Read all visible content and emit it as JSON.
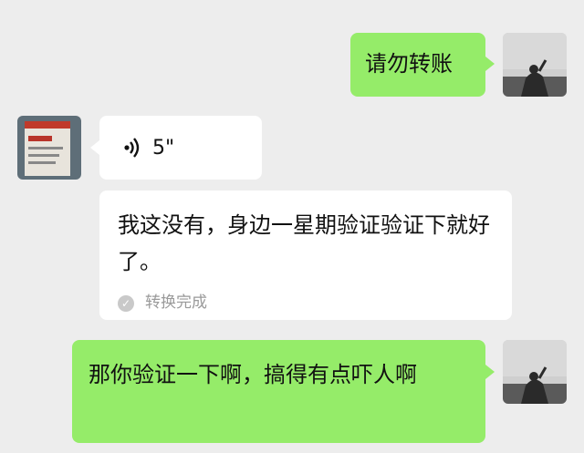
{
  "messages": {
    "m1": {
      "text": "请勿转账"
    },
    "m2": {
      "duration": "5\""
    },
    "m3": {
      "transcript": "我这没有，身边一星期验证验证下就好了。",
      "status": "转换完成"
    },
    "m4": {
      "text": "那你验证一下啊，搞得有点吓人啊"
    }
  },
  "icons": {
    "voice": "voice-wave-icon",
    "check": "check-circle-icon"
  },
  "colors": {
    "background": "#ededed",
    "outgoing_bubble": "#95ec69",
    "incoming_bubble": "#ffffff",
    "status_text": "#9a9a9a"
  }
}
